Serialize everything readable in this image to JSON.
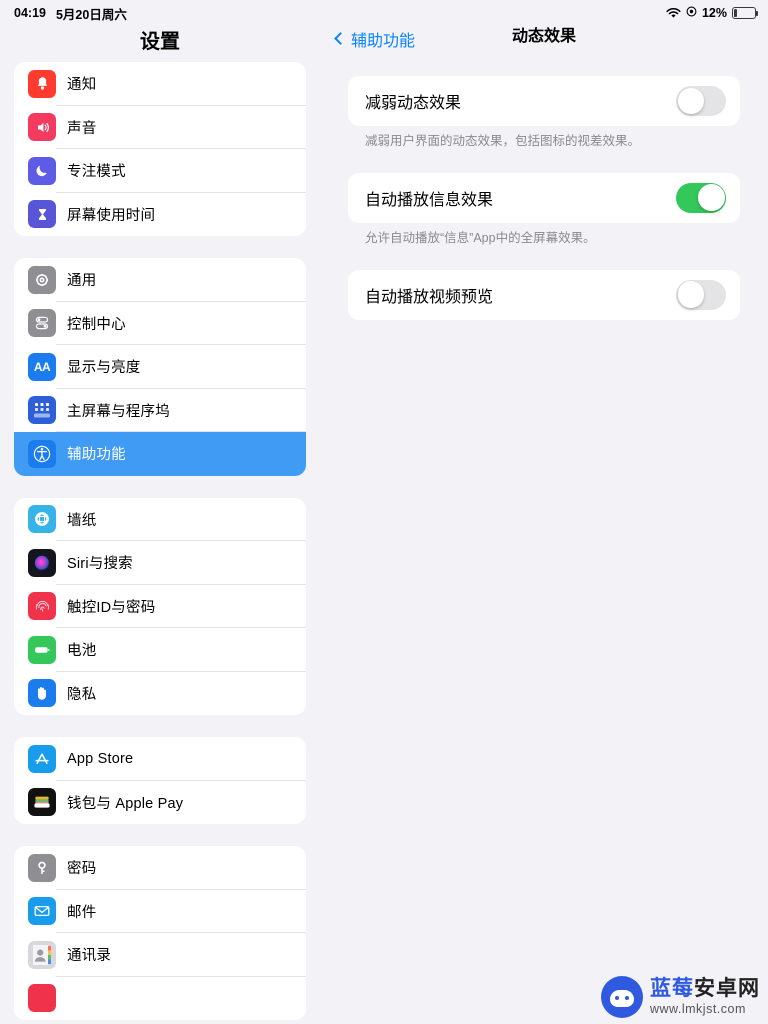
{
  "statusbar": {
    "time": "04:19",
    "date": "5月20日周六",
    "wifi_icon": "wifi-icon",
    "location_icon": "location-icon",
    "battery_percent": "12%",
    "battery_icon": "battery-icon"
  },
  "sidebar": {
    "title": "设置",
    "groups": [
      {
        "items": [
          {
            "label": "通知",
            "icon": "bell-icon",
            "color": "#ff3b30",
            "selected": false
          },
          {
            "label": "声音",
            "icon": "speaker-icon",
            "color": "#f23b5f",
            "selected": false
          },
          {
            "label": "专注模式",
            "icon": "moon-icon",
            "color": "#5e5ce6",
            "selected": false
          },
          {
            "label": "屏幕使用时间",
            "icon": "hourglass-icon",
            "color": "#5856d6",
            "selected": false
          }
        ]
      },
      {
        "items": [
          {
            "label": "通用",
            "icon": "gear-icon",
            "color": "#8e8e93",
            "selected": false
          },
          {
            "label": "控制中心",
            "icon": "control-toggles-icon",
            "color": "#8e8e93",
            "selected": false
          },
          {
            "label": "显示与亮度",
            "icon": "aa-text-icon",
            "color": "#1a7ced",
            "selected": false
          },
          {
            "label": "主屏幕与程序坞",
            "icon": "home-grid-icon",
            "color": "#2c5fd8",
            "selected": false
          },
          {
            "label": "辅助功能",
            "icon": "accessibility-icon",
            "color": "#1a7ced",
            "selected": true
          }
        ]
      },
      {
        "items": [
          {
            "label": "墙纸",
            "icon": "wallpaper-flower-icon",
            "color": "#38b3e8",
            "selected": false
          },
          {
            "label": "Siri与搜索",
            "icon": "siri-orb-icon",
            "color": "#1c1c2e",
            "selected": false
          },
          {
            "label": "触控ID与密码",
            "icon": "fingerprint-icon",
            "color": "#f0324b",
            "selected": false
          },
          {
            "label": "电池",
            "icon": "battery-green-icon",
            "color": "#34c759",
            "selected": false
          },
          {
            "label": "隐私",
            "icon": "hand-privacy-icon",
            "color": "#1a7ced",
            "selected": false
          }
        ]
      },
      {
        "items": [
          {
            "label": "App Store",
            "icon": "appstore-icon",
            "color": "#1a9ced",
            "selected": false
          },
          {
            "label": "钱包与 Apple Pay",
            "icon": "wallet-icon",
            "color": "#111111",
            "selected": false
          }
        ]
      },
      {
        "items": [
          {
            "label": "密码",
            "icon": "key-icon",
            "color": "#8e8e93",
            "selected": false
          },
          {
            "label": "邮件",
            "icon": "mail-envelope-icon",
            "color": "#1a9ced",
            "selected": false
          },
          {
            "label": "通讯录",
            "icon": "contacts-icon",
            "color": "#b0b0b5",
            "selected": false
          }
        ]
      }
    ]
  },
  "detail": {
    "back_label": "辅助功能",
    "back_icon": "chevron-left-icon",
    "title": "动态效果",
    "sections": [
      {
        "label": "减弱动态效果",
        "toggle": "off",
        "footnote": "减弱用户界面的动态效果，包括图标的视差效果。"
      },
      {
        "label": "自动播放信息效果",
        "toggle": "on",
        "footnote": "允许自动播放“信息”App中的全屏幕效果。"
      },
      {
        "label": "自动播放视频预览",
        "toggle": "off",
        "footnote": ""
      }
    ]
  },
  "annotation": {
    "arrow_icon": "red-arrow-pointer",
    "arrow_color": "#e8463c"
  },
  "watermark": {
    "brand_blue": "蓝莓",
    "brand_dark": "安卓网",
    "url": "www.lmkjst.com",
    "logo_icon": "blueberry-robot-logo"
  },
  "colors": {
    "accent_blue": "#0a84ff",
    "selected_row": "#3f9bf3",
    "toggle_on": "#34c759",
    "toggle_off": "#e4e4e6",
    "page_bg": "#f2f2f7"
  }
}
